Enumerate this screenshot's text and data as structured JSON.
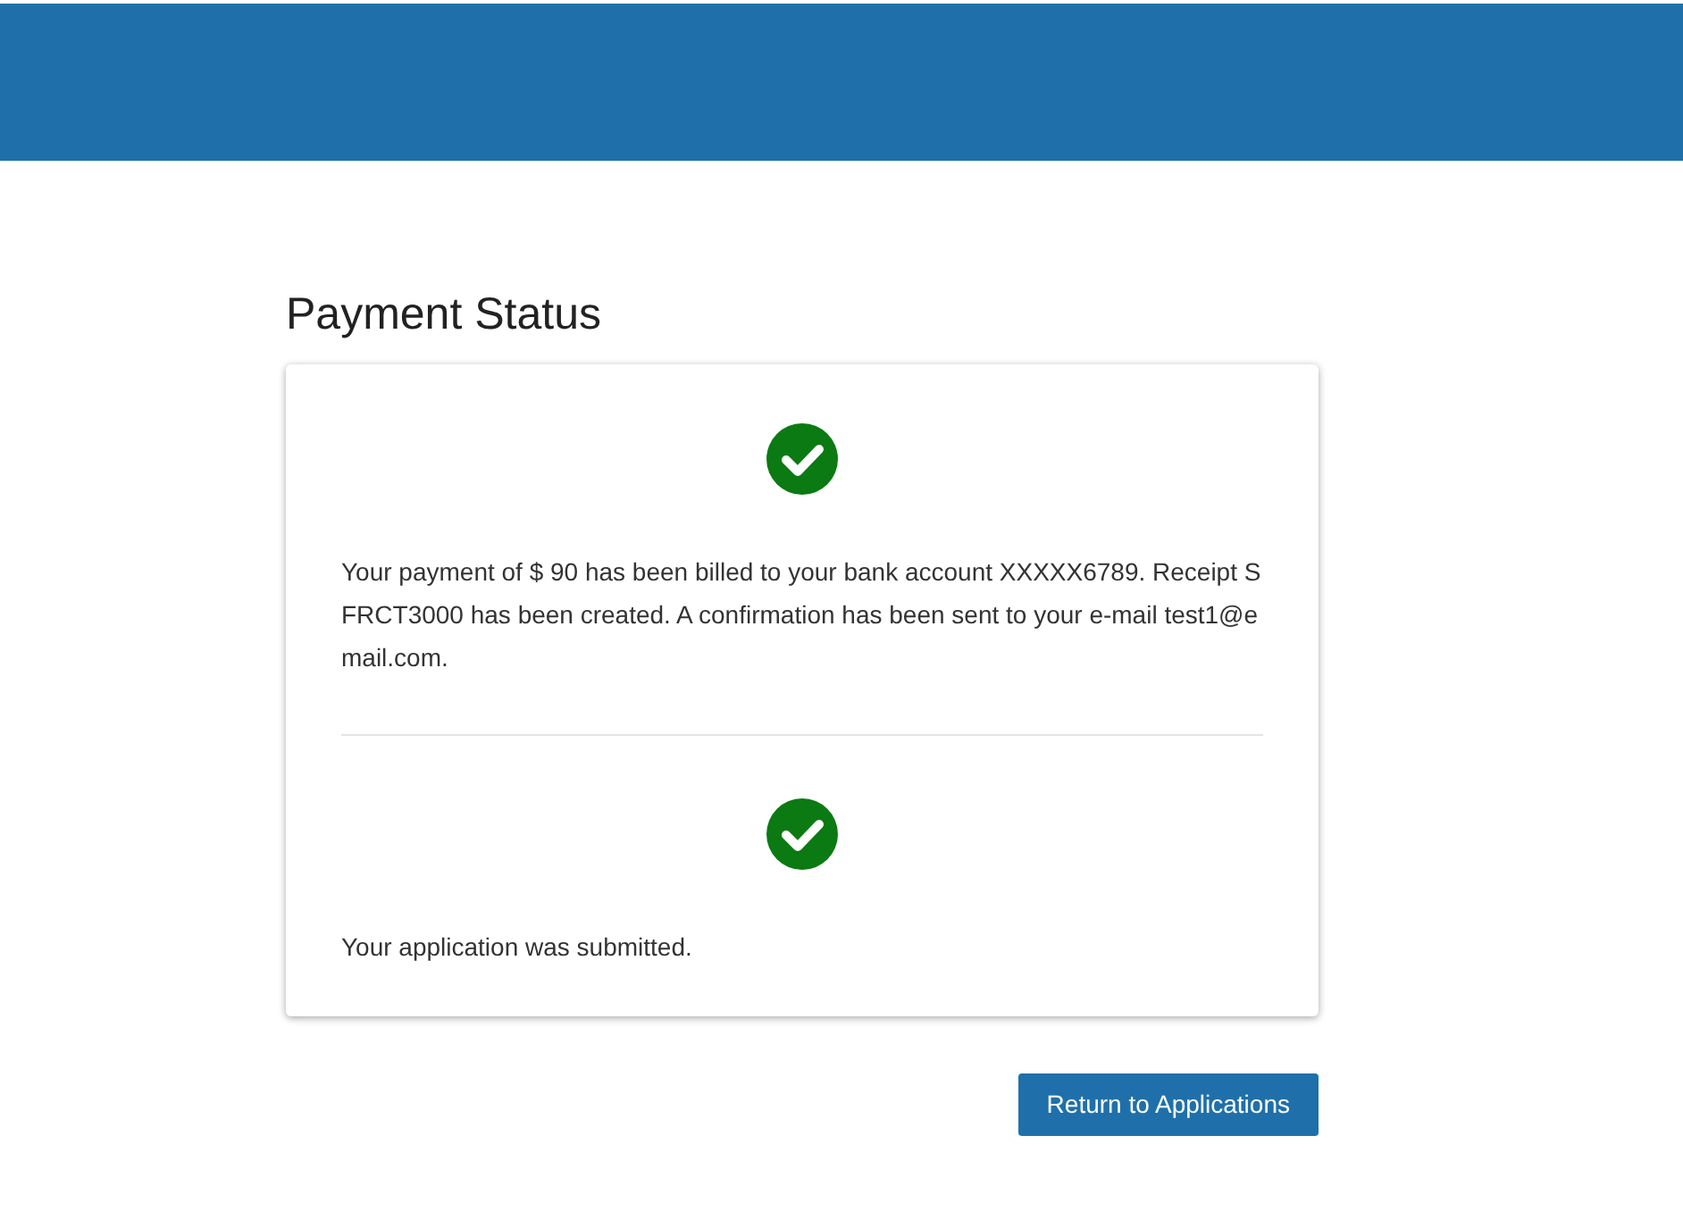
{
  "page": {
    "title": "Payment Status"
  },
  "statuses": [
    {
      "kind": "success",
      "message": "Your payment of $ 90 has been billed to your bank account XXXXX6789. Receipt SFRCT3000 has been created. A confirmation has been sent to your e-mail test1@email.com."
    },
    {
      "kind": "success",
      "message": "Your application was submitted."
    }
  ],
  "button": {
    "label": "Return to Applications"
  }
}
